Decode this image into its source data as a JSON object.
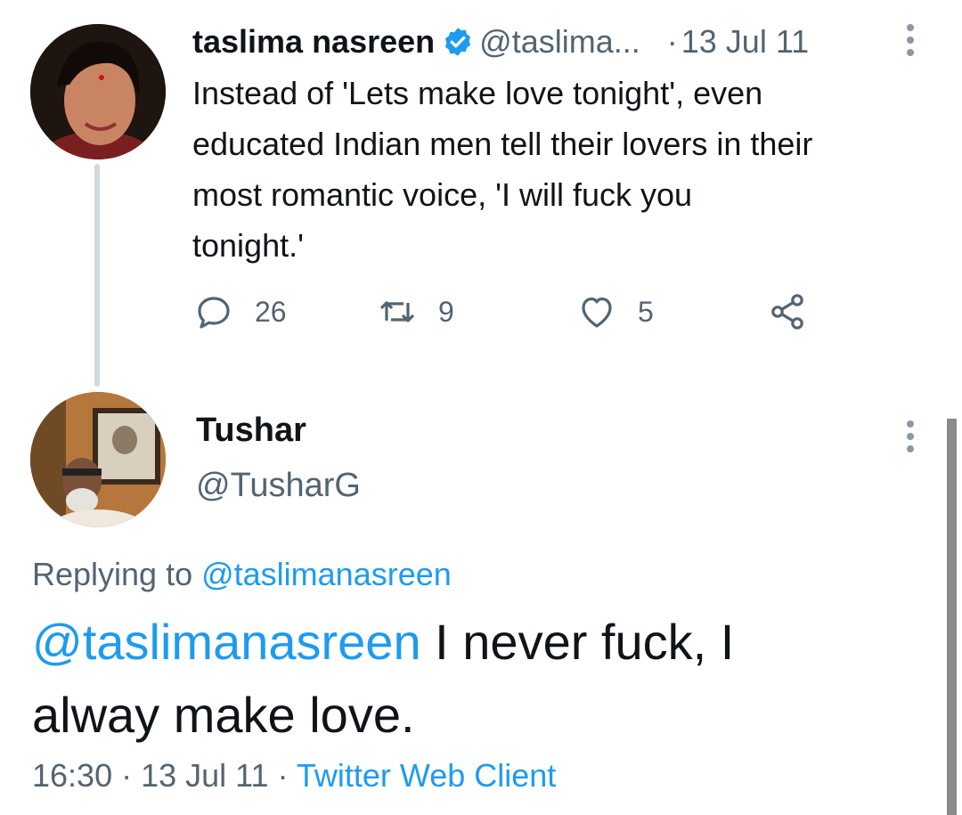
{
  "tweet1": {
    "name": "taslima nasreen",
    "handle": "@taslima...",
    "separator": "·",
    "date": "13 Jul 11",
    "text_lines": [
      "Instead of 'Lets make love tonight', even",
      "educated Indian men tell their lovers in their",
      "most romantic voice, 'I will fuck you",
      "tonight.'"
    ],
    "reply_count": "26",
    "retweet_count": "9",
    "like_count": "5",
    "icons": [
      "verified-badge-icon",
      "more-vertical-icon",
      "reply-icon",
      "retweet-icon",
      "like-icon",
      "share-icon"
    ]
  },
  "tweet2": {
    "name": "Tushar",
    "handle": "@TusharG",
    "replying_prefix": "Replying to ",
    "replying_to": "@taslimanasreen",
    "text_mention": "@taslimanasreen",
    "text_line1_rest": " I never fuck, I",
    "text_line2": "alway make love.",
    "time": "16:30",
    "date": "13 Jul 11",
    "sep": " · ",
    "client": "Twitter Web Client"
  },
  "colors": {
    "accent": "#1d9bf0",
    "secondary_text": "#536471",
    "primary_text": "#0f1419",
    "thread_line": "#cfd9de"
  }
}
